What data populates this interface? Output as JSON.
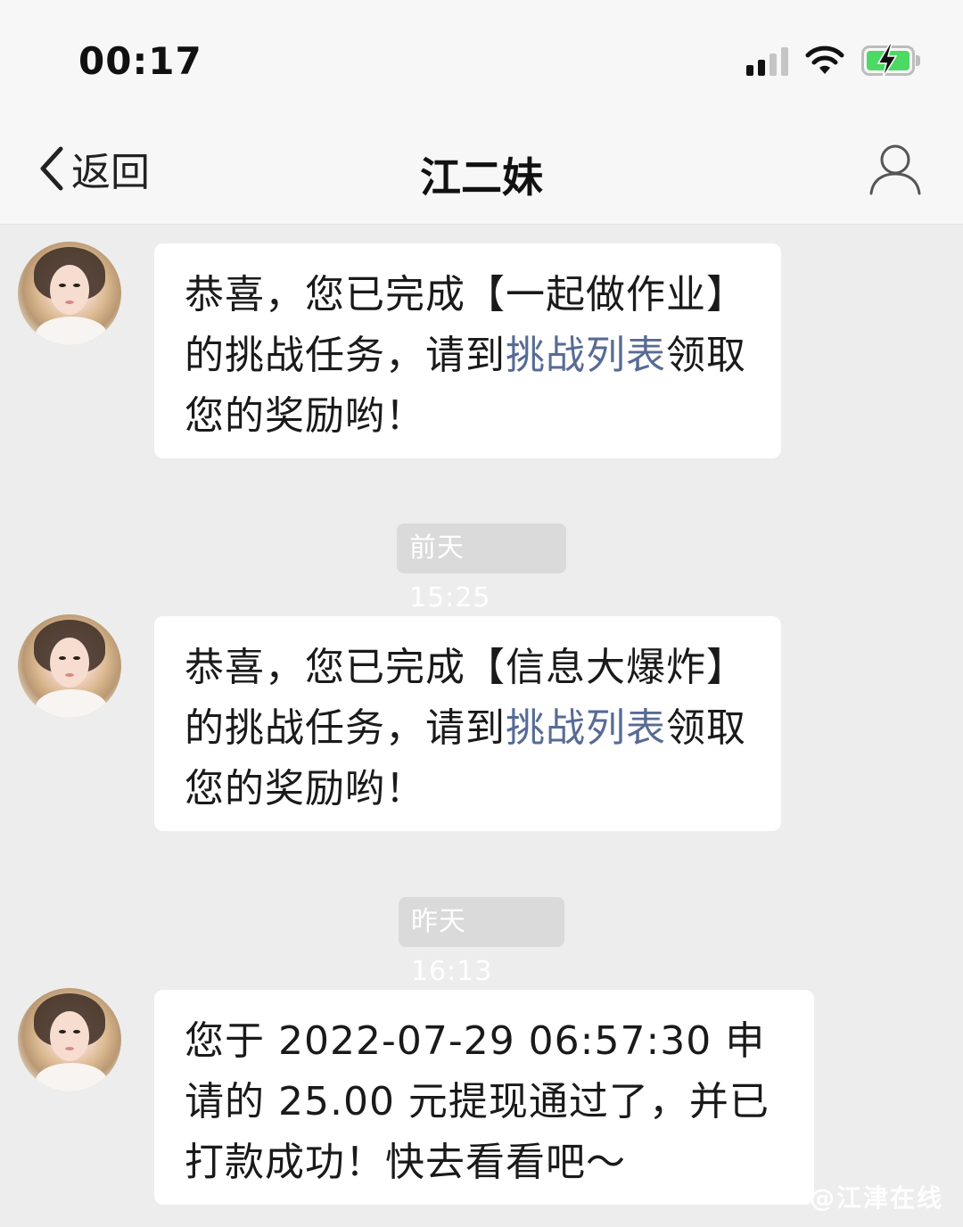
{
  "status_bar": {
    "time": "00:17",
    "battery_color": "#4cd964"
  },
  "nav": {
    "back_label": "返回",
    "title": "江二妹",
    "back_icon": "chevron-left-icon",
    "profile_icon": "person-icon"
  },
  "messages": [
    {
      "type": "text",
      "parts": [
        "恭喜，您已完成【一起做作业】的挑战任务，请到",
        "挑战列表",
        "领取您的奖励哟！"
      ],
      "link_color": "#576b95"
    },
    {
      "type": "time",
      "text": "前天 15:25"
    },
    {
      "type": "text",
      "parts": [
        "恭喜，您已完成【信息大爆炸】的挑战任务，请到",
        "挑战列表",
        "领取您的奖励哟！"
      ]
    },
    {
      "type": "time",
      "text": "昨天 16:13"
    },
    {
      "type": "text",
      "text": "您于 2022-07-29 06:57:30 申请的 25.00 元提现通过了，并已打款成功！快去看看吧～"
    }
  ],
  "watermark": "@江津在线"
}
